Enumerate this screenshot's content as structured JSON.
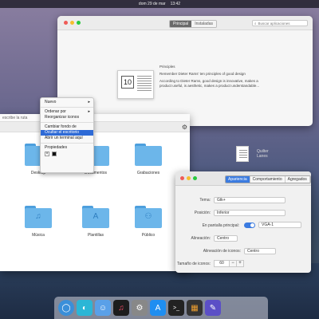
{
  "topbar": {
    "date": "dom 29 de mar",
    "time": "13:42"
  },
  "app_center": {
    "tabs": [
      {
        "label": "Principal",
        "active": true
      },
      {
        "label": "Instaladas",
        "active": false
      }
    ],
    "search_placeholder": "Buscar aplicaciones",
    "book_number": "10",
    "title": "Principles",
    "subtitle": "Remember Dieter Rams' ten principles of good design",
    "description_line1": "According to Dieter Rams, good design is innovative, makes a",
    "description_line2": "product useful, is aesthetic, makes a product understandable..."
  },
  "file_manager": {
    "path": "escribe la ruta",
    "folders": [
      {
        "label": "Desktop",
        "icon": "desktop-folder-icon",
        "glyph": ""
      },
      {
        "label": "Documentos",
        "icon": "documents-folder-icon",
        "glyph": ""
      },
      {
        "label": "Grabaciones",
        "icon": "recordings-folder-icon",
        "glyph": ""
      },
      {
        "label": "Música",
        "icon": "music-folder-icon",
        "glyph": "♫"
      },
      {
        "label": "Plantillas",
        "icon": "templates-folder-icon",
        "glyph": "A"
      },
      {
        "label": "Público",
        "icon": "public-folder-icon",
        "glyph": "⚇"
      }
    ]
  },
  "context_menu": {
    "items": [
      {
        "label": "Nuevo",
        "submenu": true
      },
      {
        "label": "Ordenar por",
        "submenu": true
      },
      {
        "label": "Reorganizar iconos",
        "submenu": false
      },
      {
        "label": "Cambiar fondo de pantalla",
        "submenu": false
      },
      {
        "label": "Ocultar el escritorio",
        "submenu": false,
        "highlighted": true
      },
      {
        "label": "Abrir un terminal aquí",
        "submenu": false
      },
      {
        "label": "Propiedades",
        "submenu": false
      }
    ]
  },
  "desktop_file": {
    "line1": "Quilter",
    "line2": "Lanes"
  },
  "settings": {
    "tabs": [
      {
        "label": "Apariencia",
        "active": true
      },
      {
        "label": "Comportamiento",
        "active": false
      },
      {
        "label": "Agregados",
        "active": false
      }
    ],
    "theme_label": "Tema:",
    "theme_value": "Gtk+",
    "position_label": "Posición:",
    "position_value": "Inferior",
    "primary_label": "En pantalla principal:",
    "primary_value": "VGA-1",
    "alignment_label": "Alineación:",
    "alignment_value": "Centro",
    "icon_align_label": "Alineación de iconos:",
    "icon_align_value": "Centro",
    "icon_size_label": "Tamaño de iconos:",
    "icon_size_value": "60",
    "stepper_minus": "−",
    "stepper_plus": "+"
  },
  "dock": {
    "apps": [
      {
        "name": "browser-icon",
        "glyph": "◯",
        "color": "#3a8fd9"
      },
      {
        "name": "messages-icon",
        "glyph": "◐",
        "color": "#2bb6d6"
      },
      {
        "name": "finder-icon",
        "glyph": "☺",
        "color": "#5aa0e8"
      },
      {
        "name": "music-icon",
        "glyph": "♫",
        "color": "#1d1d1d"
      },
      {
        "name": "settings-icon",
        "glyph": "⚙",
        "color": "#888888"
      },
      {
        "name": "appstore-icon",
        "glyph": "A",
        "color": "#1f8ef1"
      },
      {
        "name": "terminal-icon",
        "glyph": ">_",
        "color": "#222222"
      },
      {
        "name": "monitor-icon",
        "glyph": "▦",
        "color": "#333333"
      },
      {
        "name": "notes-icon",
        "glyph": "✎",
        "color": "#5b4fc6"
      }
    ]
  }
}
